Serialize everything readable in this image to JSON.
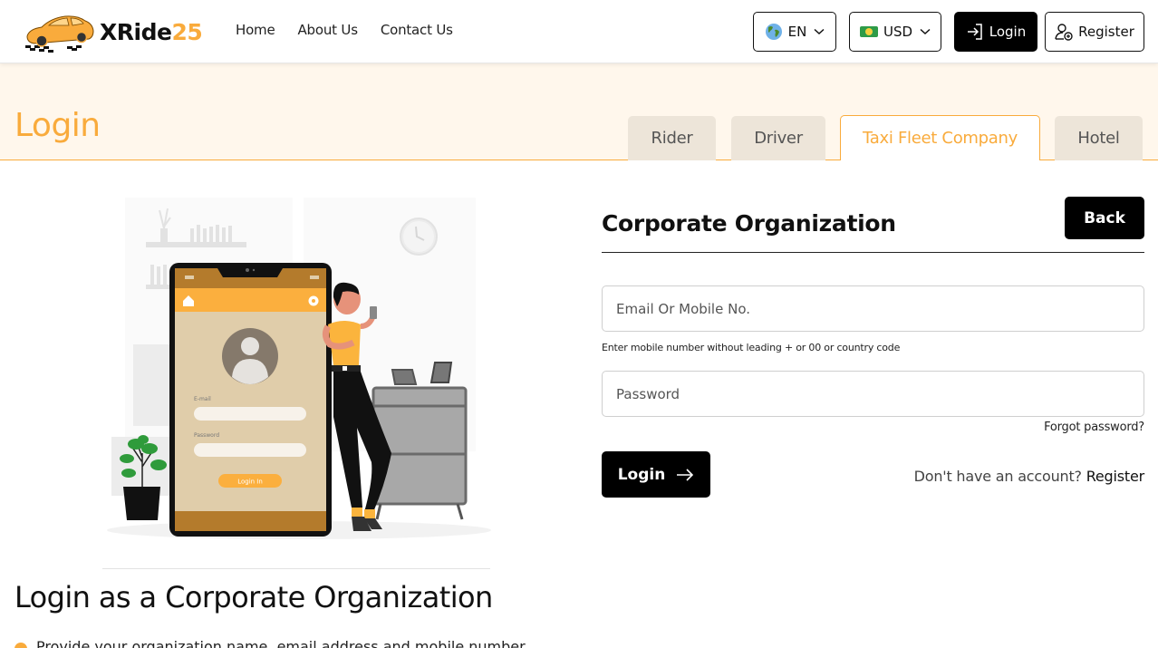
{
  "header": {
    "brand_name": "XRide",
    "brand_number": "25",
    "nav": [
      {
        "label": "Home"
      },
      {
        "label": "About Us"
      },
      {
        "label": "Contact Us"
      }
    ],
    "language": {
      "value": "EN",
      "icon": "globe-icon"
    },
    "currency": {
      "value": "USD",
      "icon": "money-icon"
    },
    "login_label": "Login",
    "register_label": "Register"
  },
  "banner": {
    "title": "Login",
    "tabs": [
      {
        "label": "Rider",
        "active": false
      },
      {
        "label": "Driver",
        "active": false
      },
      {
        "label": "Taxi Fleet Company",
        "active": true
      },
      {
        "label": "Hotel",
        "active": false
      }
    ]
  },
  "illustration": {
    "email_label": "E-mail",
    "password_label": "Password",
    "button_label": "Login In"
  },
  "form": {
    "title": "Corporate Organization",
    "back_label": "Back",
    "email_placeholder": "Email Or Mobile No.",
    "email_value": "",
    "hint": "Enter mobile number without leading + or 00 or country code",
    "password_placeholder": "Password",
    "password_value": "",
    "forgot_label": "Forgot password?",
    "submit_label": "Login",
    "signup_prompt": "Don't have an account?",
    "signup_link": "Register"
  },
  "about": {
    "title": "Login as a Corporate Organization",
    "bullet_partial": "Provide your organization name, email address and mobile number"
  },
  "colors": {
    "accent": "#f9ab3c",
    "banner_bg": "#fff7ec",
    "tab_bg": "#ede5d9",
    "dark": "#000000"
  }
}
